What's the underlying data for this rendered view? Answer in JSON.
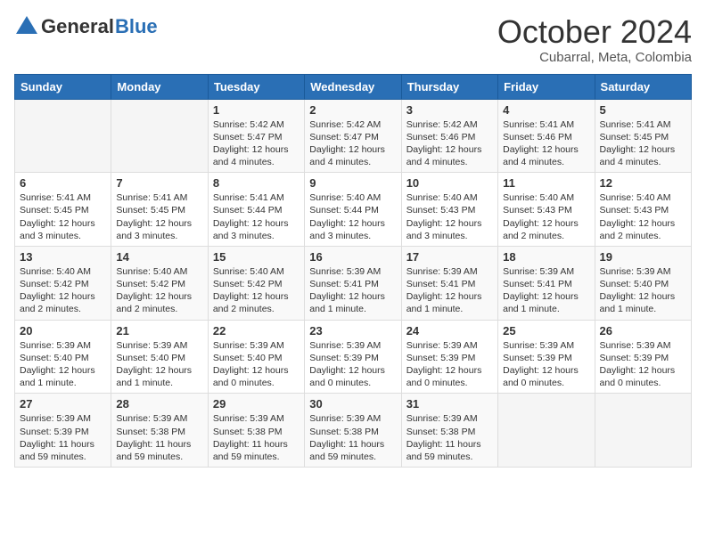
{
  "header": {
    "logo_general": "General",
    "logo_blue": "Blue",
    "month_title": "October 2024",
    "subtitle": "Cubarral, Meta, Colombia"
  },
  "weekdays": [
    "Sunday",
    "Monday",
    "Tuesday",
    "Wednesday",
    "Thursday",
    "Friday",
    "Saturday"
  ],
  "weeks": [
    [
      {
        "day": "",
        "detail": ""
      },
      {
        "day": "",
        "detail": ""
      },
      {
        "day": "1",
        "detail": "Sunrise: 5:42 AM\nSunset: 5:47 PM\nDaylight: 12 hours and 4 minutes."
      },
      {
        "day": "2",
        "detail": "Sunrise: 5:42 AM\nSunset: 5:47 PM\nDaylight: 12 hours and 4 minutes."
      },
      {
        "day": "3",
        "detail": "Sunrise: 5:42 AM\nSunset: 5:46 PM\nDaylight: 12 hours and 4 minutes."
      },
      {
        "day": "4",
        "detail": "Sunrise: 5:41 AM\nSunset: 5:46 PM\nDaylight: 12 hours and 4 minutes."
      },
      {
        "day": "5",
        "detail": "Sunrise: 5:41 AM\nSunset: 5:45 PM\nDaylight: 12 hours and 4 minutes."
      }
    ],
    [
      {
        "day": "6",
        "detail": "Sunrise: 5:41 AM\nSunset: 5:45 PM\nDaylight: 12 hours and 3 minutes."
      },
      {
        "day": "7",
        "detail": "Sunrise: 5:41 AM\nSunset: 5:45 PM\nDaylight: 12 hours and 3 minutes."
      },
      {
        "day": "8",
        "detail": "Sunrise: 5:41 AM\nSunset: 5:44 PM\nDaylight: 12 hours and 3 minutes."
      },
      {
        "day": "9",
        "detail": "Sunrise: 5:40 AM\nSunset: 5:44 PM\nDaylight: 12 hours and 3 minutes."
      },
      {
        "day": "10",
        "detail": "Sunrise: 5:40 AM\nSunset: 5:43 PM\nDaylight: 12 hours and 3 minutes."
      },
      {
        "day": "11",
        "detail": "Sunrise: 5:40 AM\nSunset: 5:43 PM\nDaylight: 12 hours and 2 minutes."
      },
      {
        "day": "12",
        "detail": "Sunrise: 5:40 AM\nSunset: 5:43 PM\nDaylight: 12 hours and 2 minutes."
      }
    ],
    [
      {
        "day": "13",
        "detail": "Sunrise: 5:40 AM\nSunset: 5:42 PM\nDaylight: 12 hours and 2 minutes."
      },
      {
        "day": "14",
        "detail": "Sunrise: 5:40 AM\nSunset: 5:42 PM\nDaylight: 12 hours and 2 minutes."
      },
      {
        "day": "15",
        "detail": "Sunrise: 5:40 AM\nSunset: 5:42 PM\nDaylight: 12 hours and 2 minutes."
      },
      {
        "day": "16",
        "detail": "Sunrise: 5:39 AM\nSunset: 5:41 PM\nDaylight: 12 hours and 1 minute."
      },
      {
        "day": "17",
        "detail": "Sunrise: 5:39 AM\nSunset: 5:41 PM\nDaylight: 12 hours and 1 minute."
      },
      {
        "day": "18",
        "detail": "Sunrise: 5:39 AM\nSunset: 5:41 PM\nDaylight: 12 hours and 1 minute."
      },
      {
        "day": "19",
        "detail": "Sunrise: 5:39 AM\nSunset: 5:40 PM\nDaylight: 12 hours and 1 minute."
      }
    ],
    [
      {
        "day": "20",
        "detail": "Sunrise: 5:39 AM\nSunset: 5:40 PM\nDaylight: 12 hours and 1 minute."
      },
      {
        "day": "21",
        "detail": "Sunrise: 5:39 AM\nSunset: 5:40 PM\nDaylight: 12 hours and 1 minute."
      },
      {
        "day": "22",
        "detail": "Sunrise: 5:39 AM\nSunset: 5:40 PM\nDaylight: 12 hours and 0 minutes."
      },
      {
        "day": "23",
        "detail": "Sunrise: 5:39 AM\nSunset: 5:39 PM\nDaylight: 12 hours and 0 minutes."
      },
      {
        "day": "24",
        "detail": "Sunrise: 5:39 AM\nSunset: 5:39 PM\nDaylight: 12 hours and 0 minutes."
      },
      {
        "day": "25",
        "detail": "Sunrise: 5:39 AM\nSunset: 5:39 PM\nDaylight: 12 hours and 0 minutes."
      },
      {
        "day": "26",
        "detail": "Sunrise: 5:39 AM\nSunset: 5:39 PM\nDaylight: 12 hours and 0 minutes."
      }
    ],
    [
      {
        "day": "27",
        "detail": "Sunrise: 5:39 AM\nSunset: 5:39 PM\nDaylight: 11 hours and 59 minutes."
      },
      {
        "day": "28",
        "detail": "Sunrise: 5:39 AM\nSunset: 5:38 PM\nDaylight: 11 hours and 59 minutes."
      },
      {
        "day": "29",
        "detail": "Sunrise: 5:39 AM\nSunset: 5:38 PM\nDaylight: 11 hours and 59 minutes."
      },
      {
        "day": "30",
        "detail": "Sunrise: 5:39 AM\nSunset: 5:38 PM\nDaylight: 11 hours and 59 minutes."
      },
      {
        "day": "31",
        "detail": "Sunrise: 5:39 AM\nSunset: 5:38 PM\nDaylight: 11 hours and 59 minutes."
      },
      {
        "day": "",
        "detail": ""
      },
      {
        "day": "",
        "detail": ""
      }
    ]
  ]
}
